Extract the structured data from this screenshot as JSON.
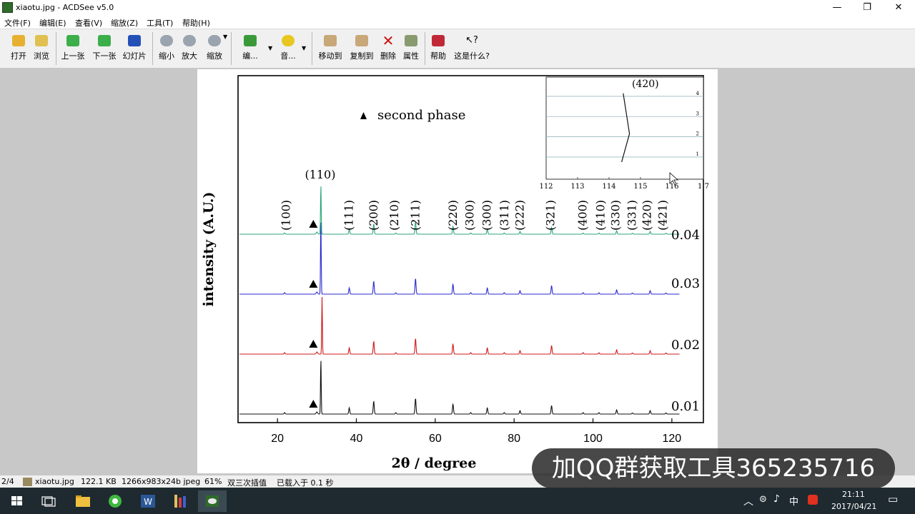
{
  "window": {
    "title": "xiaotu.jpg - ACDSee v5.0",
    "controls": [
      "—",
      "❐",
      "✕"
    ]
  },
  "menu": [
    "文件(F)",
    "编辑(E)",
    "查看(V)",
    "缩放(Z)",
    "工具(T)",
    "帮助(H)"
  ],
  "toolbar": {
    "open": "打开",
    "browse": "浏览",
    "prev": "上一张",
    "next": "下一张",
    "slideshow": "幻灯片",
    "zoom_out": "缩小",
    "zoom_in": "放大",
    "zoom": "缩放",
    "edit": "编...",
    "audio": "音...",
    "move_to": "移动到",
    "copy_to": "复制到",
    "delete": "删除",
    "properties": "属性",
    "help": "帮助",
    "whats_this": "这是什么?"
  },
  "status": {
    "position": "2/4",
    "filename": "xiaotu.jpg",
    "filesize": "122.1 KB",
    "format": "1266x983x24b jpeg",
    "zoom": "61%",
    "resample": "双三次插值",
    "load_time": "已载入于 0.1 秒"
  },
  "overlay_text": "加QQ群获取工具365235716",
  "taskbar": {
    "tray_lang": "中",
    "time": "21:11",
    "date": "2017/04/21"
  },
  "colors": {
    "green": "#2ca67a",
    "blue": "#2a2ad0",
    "red": "#d01818",
    "black": "#111111"
  },
  "chart_data": {
    "type": "line",
    "xlabel": "2θ / degree",
    "ylabel": "intensity (A.U.)",
    "xlim": [
      10,
      128
    ],
    "x_ticks": [
      20,
      40,
      60,
      80,
      100,
      120
    ],
    "legend": "second phase",
    "legend_placement": "top-left",
    "second_phase_x": 30.0,
    "series": [
      {
        "name": "0.01",
        "color": "#111111",
        "main_peak": 31.0
      },
      {
        "name": "0.02",
        "color": "#d01818",
        "main_peak": 31.3
      },
      {
        "name": "0.03",
        "color": "#2a2ad0",
        "main_peak": 31.0
      },
      {
        "name": "0.04",
        "color": "#2ca67a",
        "main_peak": 31.0
      }
    ],
    "minor_peaks": [
      {
        "x": 21.8,
        "h": 0.05
      },
      {
        "x": 38.2,
        "h": 0.22
      },
      {
        "x": 44.4,
        "h": 0.45
      },
      {
        "x": 50.0,
        "h": 0.05
      },
      {
        "x": 55.0,
        "h": 0.55
      },
      {
        "x": 64.5,
        "h": 0.35
      },
      {
        "x": 69.0,
        "h": 0.05
      },
      {
        "x": 73.2,
        "h": 0.22
      },
      {
        "x": 77.5,
        "h": 0.05
      },
      {
        "x": 81.5,
        "h": 0.12
      },
      {
        "x": 89.5,
        "h": 0.3
      },
      {
        "x": 97.5,
        "h": 0.05
      },
      {
        "x": 101.5,
        "h": 0.05
      },
      {
        "x": 106.0,
        "h": 0.15
      },
      {
        "x": 110.0,
        "h": 0.04
      },
      {
        "x": 114.5,
        "h": 0.12
      },
      {
        "x": 118.5,
        "h": 0.04
      }
    ],
    "peak_labels": [
      {
        "text": "(110)",
        "x": 31.2,
        "vertical": false
      },
      {
        "text": "(100)",
        "x": 22.2,
        "vertical": true
      },
      {
        "text": "(111)",
        "x": 38.2,
        "vertical": true
      },
      {
        "text": "(200)",
        "x": 44.4,
        "vertical": true
      },
      {
        "text": "(210)",
        "x": 49.7,
        "vertical": true
      },
      {
        "text": "(211)",
        "x": 55.0,
        "vertical": true
      },
      {
        "text": "(220)",
        "x": 64.6,
        "vertical": true
      },
      {
        "text": "(300)",
        "x": 68.8,
        "vertical": true
      },
      {
        "text": "(300)",
        "x": 73.2,
        "vertical": true
      },
      {
        "text": "(311)",
        "x": 77.6,
        "vertical": true
      },
      {
        "text": "(222)",
        "x": 81.5,
        "vertical": true
      },
      {
        "text": "(321)",
        "x": 89.3,
        "vertical": true
      },
      {
        "text": "(400)",
        "x": 97.5,
        "vertical": true
      },
      {
        "text": "(410)",
        "x": 102.0,
        "vertical": true
      },
      {
        "text": "(330)",
        "x": 105.8,
        "vertical": true
      },
      {
        "text": "(331)",
        "x": 110.0,
        "vertical": true
      },
      {
        "text": "(420)",
        "x": 113.8,
        "vertical": true
      },
      {
        "text": "(421)",
        "x": 117.8,
        "vertical": true
      }
    ],
    "inset": {
      "label": "(420)",
      "xlim": [
        112,
        117
      ],
      "x_ticks": [
        "112",
        "113",
        "114",
        "115",
        "116",
        "1 7"
      ],
      "y_ticks": [
        "1",
        "2",
        "3",
        "4"
      ],
      "line_points": [
        [
          114.4,
          0.6
        ],
        [
          114.65,
          2.0
        ],
        [
          114.45,
          4.0
        ]
      ]
    }
  }
}
